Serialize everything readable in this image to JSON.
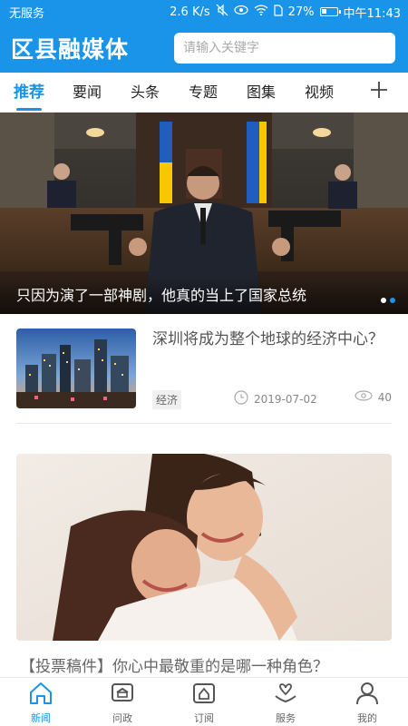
{
  "status_bar": {
    "carrier": "无服务",
    "speed": "2.6 K/s",
    "battery": "27%",
    "time": "中午11:43"
  },
  "header": {
    "title": "区县融媒体",
    "search_placeholder": "请输入关键字"
  },
  "tabs": [
    {
      "label": "推荐",
      "active": true
    },
    {
      "label": "要闻"
    },
    {
      "label": "头条"
    },
    {
      "label": "专题"
    },
    {
      "label": "图集"
    },
    {
      "label": "视频"
    }
  ],
  "tab_add_icon": "plus-icon",
  "hero": {
    "title": "只因为演了一部神剧，他真的当上了国家总统",
    "slide_index": 2,
    "slide_count": 2
  },
  "news": [
    {
      "title": "深圳将成为整个地球的经济中心？",
      "tag": "经济",
      "date": "2019-07-02",
      "views": "40"
    },
    {
      "title": "【投票稿件】你心中最敬重的是哪一种角色？"
    }
  ],
  "bottom_nav": [
    {
      "label": "新闻",
      "icon": "home-icon",
      "active": true
    },
    {
      "label": "问政",
      "icon": "chat-icon"
    },
    {
      "label": "订阅",
      "icon": "subscribe-icon"
    },
    {
      "label": "服务",
      "icon": "service-icon"
    },
    {
      "label": "我的",
      "icon": "user-icon"
    }
  ],
  "colors": {
    "brand": "#1a94e8",
    "text": "#555555"
  }
}
